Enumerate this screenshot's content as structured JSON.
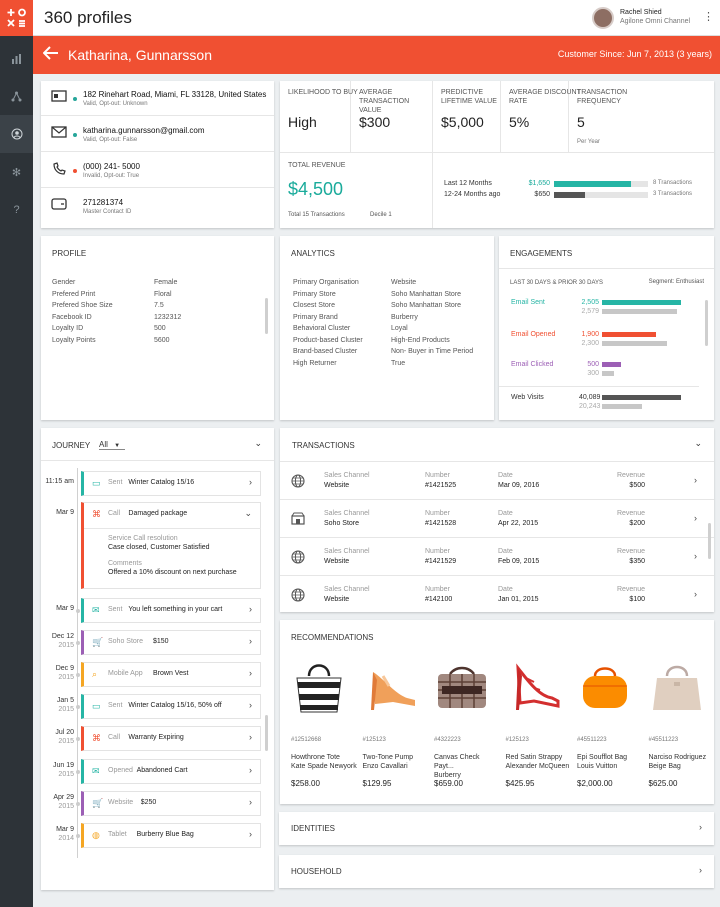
{
  "rail": {
    "logo": "+O\n×≡",
    "items": [
      {
        "icon": "bar-chart-icon"
      },
      {
        "icon": "network-icon"
      },
      {
        "icon": "person-circle-icon"
      },
      {
        "icon": "gear-icon"
      },
      {
        "icon": "help-icon"
      }
    ]
  },
  "topbar": {
    "title": "360 profiles",
    "user_name": "Rachel Shied",
    "user_channel": "Agilone Omni Channel"
  },
  "customer": {
    "name": "Katharina, Gunnarsson",
    "since": "Customer Since: Jun 7, 2013 (3 years)"
  },
  "contact": [
    {
      "icon": "address-card-icon",
      "main": "182 Rinehart Road, Miami, FL 33128, United States",
      "sub": "Valid, Opt-out: Unknown",
      "status_color": "#26a69a"
    },
    {
      "icon": "envelope-icon",
      "main": "katharina.gunnarsson@gmail.com",
      "sub": "Valid, Opt-out: False",
      "status_color": "#26a69a"
    },
    {
      "icon": "phone-icon",
      "main": "(000) 241- 5000",
      "sub": "Invalid, Opt-out: True",
      "status_color": "#f05032"
    },
    {
      "icon": "wallet-icon",
      "main": "271281374",
      "sub": "Master Contact ID",
      "status_color": ""
    }
  ],
  "metrics": [
    {
      "label": "LIKELIHOOD TO BUY",
      "value": "High",
      "per": ""
    },
    {
      "label": "AVERAGE TRANSACTION VALUE",
      "value": "$300",
      "per": ""
    },
    {
      "label": "PREDICTIVE LIFETIME VALUE",
      "value": "$5,000",
      "per": ""
    },
    {
      "label": "AVERAGE DISCOUNT RATE",
      "value": "5%",
      "per": ""
    },
    {
      "label": "TRANSACTION FREQUENCY",
      "value": "5",
      "per": "Per Year"
    }
  ],
  "revenue": {
    "label": "TOTAL REVENUE",
    "value": "$4,500",
    "transactions": "Total 15 Transactions",
    "decile": "Decile 1",
    "rows": [
      {
        "period": "Last 12 Months",
        "amount": "$1,650",
        "count": "8 Transactions",
        "fraction": 0.82,
        "color": "#26b5a5"
      },
      {
        "period": "12-24 Months ago",
        "amount": "$650",
        "count": "3 Transactions",
        "fraction": 0.33,
        "color": "#555555"
      }
    ]
  },
  "profile": {
    "title": "PROFILE",
    "rows": [
      {
        "k": "Gender",
        "v": "Female"
      },
      {
        "k": "Prefered Print",
        "v": "Floral"
      },
      {
        "k": "Prefered Shoe Size",
        "v": "7.5"
      },
      {
        "k": "Facebook ID",
        "v": "1232312"
      },
      {
        "k": "Loyalty ID",
        "v": "500"
      },
      {
        "k": "Loyalty Points",
        "v": "5600"
      }
    ]
  },
  "analytics": {
    "title": "ANALYTICS",
    "rows": [
      {
        "k": "Primary Organisation",
        "v": "Website"
      },
      {
        "k": "Primary Store",
        "v": "Soho Manhattan Store"
      },
      {
        "k": "Closest Store",
        "v": "Soho Manhattan Store"
      },
      {
        "k": "Primary  Brand",
        "v": "Burberry"
      },
      {
        "k": "Behavioral Cluster",
        "v": "Loyal"
      },
      {
        "k": "Product-based Cluster",
        "v": "High-End Products"
      },
      {
        "k": "Brand-based Cluster",
        "v": "Non- Buyer in Time Period"
      },
      {
        "k": "High Returner",
        "v": "True"
      }
    ]
  },
  "engagements": {
    "title": "ENGAGEMENTS",
    "period": "LAST 30 DAYS & PRIOR 30 DAYS",
    "segment": "Segment: Enthusiast",
    "rows": [
      {
        "name": "Email Sent",
        "color": "#26b5a5",
        "cur": "2,505",
        "prior": "2,579",
        "cur_frac": 1.0,
        "prior_frac": 0.95
      },
      {
        "name": "Email Opened",
        "color": "#f05032",
        "cur": "1,900",
        "prior": "2,300",
        "cur_frac": 0.68,
        "prior_frac": 0.82
      },
      {
        "name": "Email Clicked",
        "color": "#9c5fb5",
        "cur": "500",
        "prior": "300",
        "cur_frac": 0.24,
        "prior_frac": 0.15
      },
      {
        "name": "Web Visits",
        "color": "#555555",
        "cur": "40,089",
        "prior": "20,243",
        "cur_frac": 1.0,
        "prior_frac": 0.5
      }
    ]
  },
  "journey": {
    "title": "JOURNEY",
    "filter": "All",
    "items": [
      {
        "date": "11:15 am",
        "year": "",
        "icon": "newsletter-icon",
        "type": "Sent",
        "title": "Winter Catalog 15/16",
        "color": "#26b5a5",
        "dot": false
      },
      {
        "date": "Mar 9",
        "year": "",
        "icon": "command-icon",
        "type": "Call",
        "title": "Damaged package",
        "color": "#f05032",
        "dot": false,
        "detail": {
          "h1": "Service Call resolution",
          "t1": "Case closed, Customer Satisfied",
          "h2": "Comments",
          "t2": "Offered a 10% discount on next purchase"
        }
      },
      {
        "date": "Mar 9",
        "year": "",
        "icon": "mail-icon",
        "type": "Sent",
        "title": "You left something in your cart",
        "color": "#26b5a5",
        "dot": true
      },
      {
        "date": "Dec 12",
        "year": "2015",
        "icon": "cart-icon",
        "type": "Soho Store",
        "title": "$150",
        "color": "#9c5fb5",
        "dot": true
      },
      {
        "date": "Dec 9",
        "year": "2015",
        "icon": "search-icon",
        "type": "Mobile App",
        "title": "Brown Vest",
        "color": "#f5a623",
        "dot": true
      },
      {
        "date": "Jan 5",
        "year": "2015",
        "icon": "newsletter-icon",
        "type": "Sent",
        "title": "Winter Catalog 15/16, 50% off",
        "color": "#26b5a5",
        "dot": true
      },
      {
        "date": "Jul 20",
        "year": "2015",
        "icon": "command-icon",
        "type": "Call",
        "title": "Warranty Expiring",
        "color": "#f05032",
        "dot": true
      },
      {
        "date": "Jun 19",
        "year": "2015",
        "icon": "open-mail-icon",
        "type": "Opened",
        "title": "Abandoned Cart",
        "color": "#26b5a5",
        "dot": true
      },
      {
        "date": "Apr 29",
        "year": "2015",
        "icon": "cart-icon",
        "type": "Website",
        "title": "$250",
        "color": "#9c5fb5",
        "dot": true
      },
      {
        "date": "Mar 9",
        "year": "2014",
        "icon": "globe-icon",
        "type": "Tablet",
        "title": "Burberry Blue Bag",
        "color": "#f5a623",
        "dot": true
      }
    ]
  },
  "transactions": {
    "title": "TRANSACTIONS",
    "rows": [
      {
        "icon": "globe-icon",
        "channel_label": "Sales Channel",
        "channel": "Website",
        "num_label": "Number",
        "num": "#1421525",
        "date_label": "Date",
        "date": "Mar 09, 2016",
        "rev_label": "Revenue",
        "rev": "$500"
      },
      {
        "icon": "store-icon",
        "channel_label": "Sales Channel",
        "channel": "Soho Store",
        "num_label": "Number",
        "num": "#1421528",
        "date_label": "Date",
        "date": "Apr 22, 2015",
        "rev_label": "Revenue",
        "rev": "$200"
      },
      {
        "icon": "globe-icon",
        "channel_label": "Sales Channel",
        "channel": "Website",
        "num_label": "Number",
        "num": "#1421529",
        "date_label": "Date",
        "date": "Feb 09, 2015",
        "rev_label": "Revenue",
        "rev": "$350"
      },
      {
        "icon": "globe-icon",
        "channel_label": "Sales Channel",
        "channel": "Website",
        "num_label": "Number",
        "num": "#142100",
        "date_label": "Date",
        "date": "Jan 01, 2015",
        "rev_label": "Revenue",
        "rev": "$100"
      }
    ]
  },
  "recommendations": {
    "title": "RECOMMENDATIONS",
    "items": [
      {
        "sku": "#12512668",
        "name": "Howthrone Tote\nKate Spade Newyork",
        "price": "$258.00",
        "image": "striped-tote-image"
      },
      {
        "sku": "#125123",
        "name": "Two-Tone Pump\nEnzo Cavallari",
        "price": "$129.95",
        "image": "orange-pump-image"
      },
      {
        "sku": "#4322223",
        "name": "Canvas Check Payt...\nBurberry",
        "price": "$659.00",
        "image": "check-bag-image"
      },
      {
        "sku": "#125123",
        "name": "Red Satin Strappy\nAlexander McQueen",
        "price": "$425.95",
        "image": "red-heel-image"
      },
      {
        "sku": "#45511223",
        "name": "Epi Soufflot Bag\nLouis Vuitton",
        "price": "$2,000.00",
        "image": "orange-duffel-image"
      },
      {
        "sku": "#45511223",
        "name": "Narciso Rodriguez\nBeige Bag",
        "price": "$625.00",
        "image": "beige-bag-image"
      }
    ]
  },
  "identities": {
    "title": "IDENTITIES"
  },
  "household": {
    "title": "HOUSEHOLD"
  }
}
